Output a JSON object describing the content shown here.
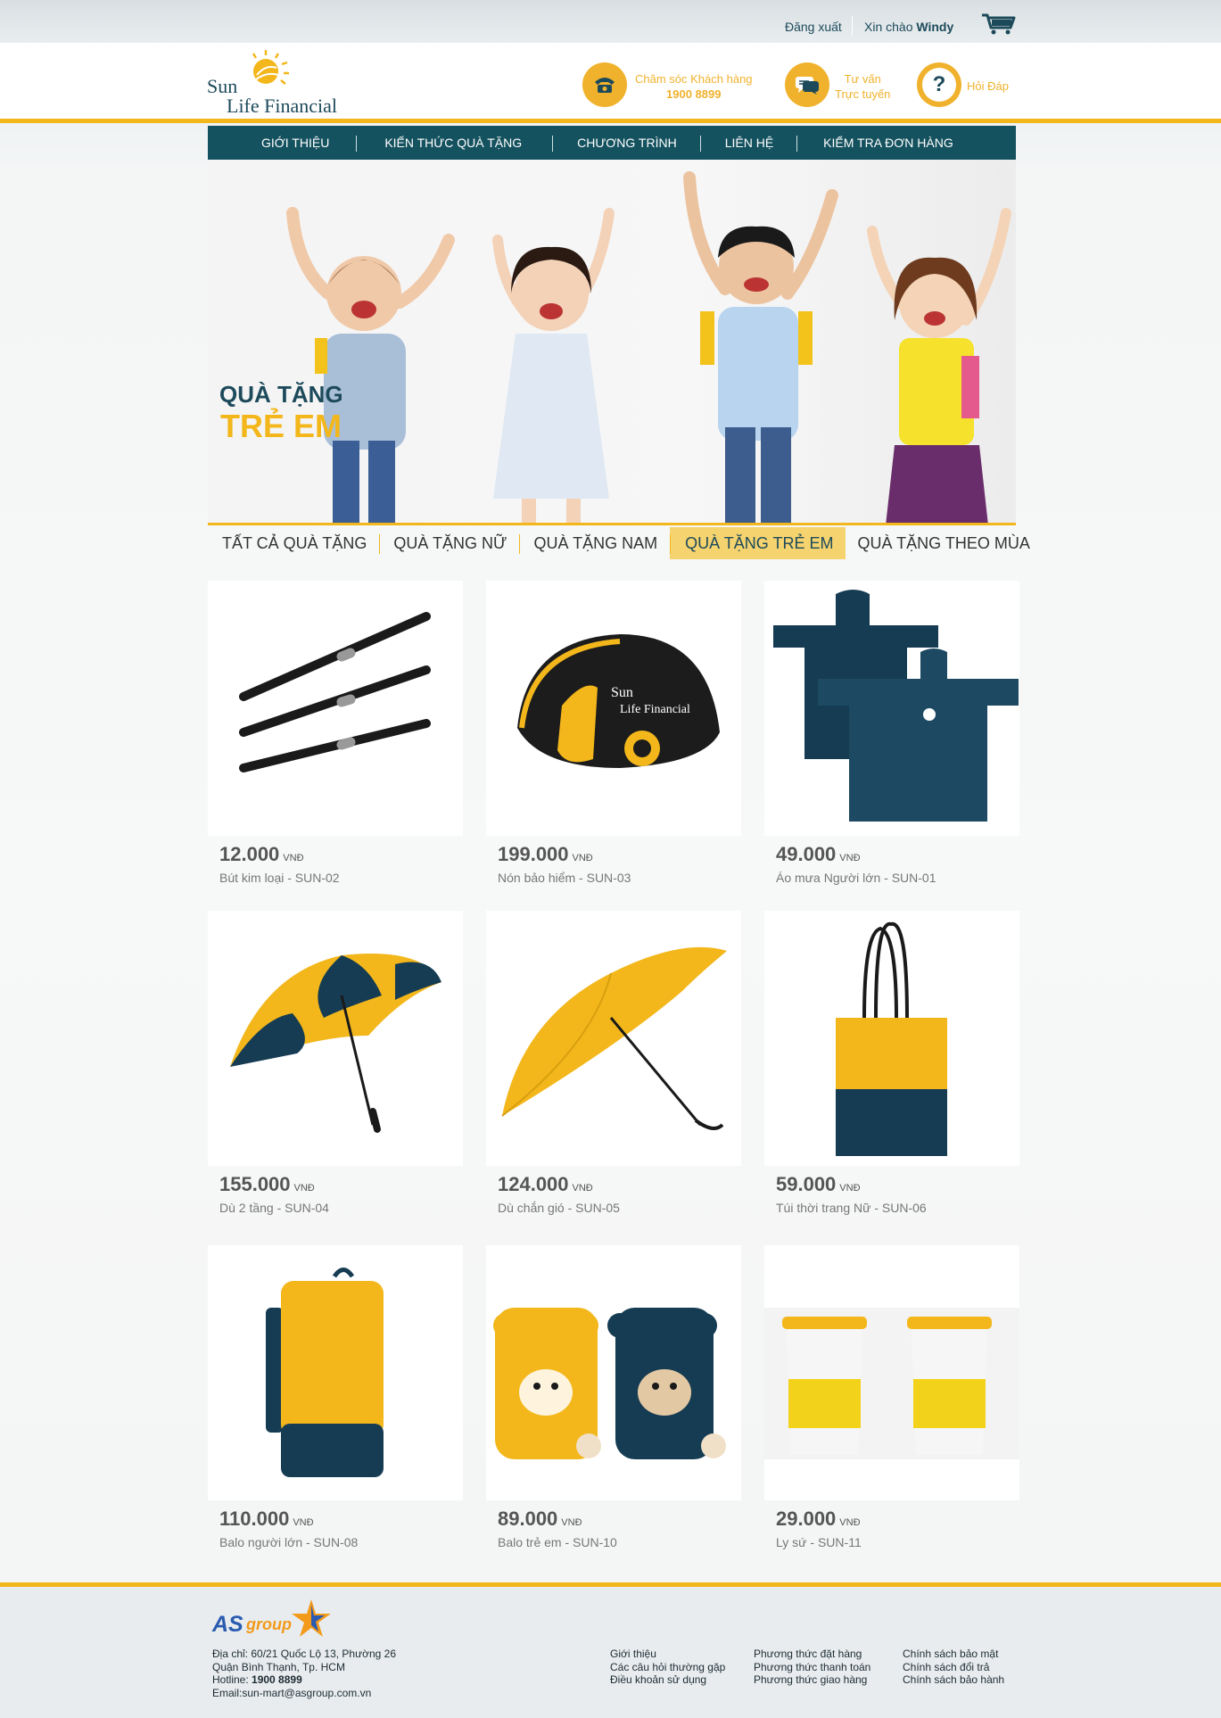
{
  "topbar": {
    "logout": "Đăng xuất",
    "greeting_prefix": "Xin chào",
    "username": "Windy",
    "cart_icon": "cart-icon"
  },
  "header": {
    "logo": {
      "line1": "Sun",
      "line2": "Life Financial"
    },
    "customer_care": {
      "label": "Chăm sóc Khách hàng",
      "phone": "1900 8899",
      "icon": "phone-icon"
    },
    "consult": {
      "line1": "Tư vấn",
      "line2": "Trực tuyến",
      "icon": "chat-icon"
    },
    "faq": {
      "label": "Hỏi Đáp",
      "icon": "question-icon"
    }
  },
  "nav": [
    "GIỚI THIỆU",
    "KIẾN THỨC QUÀ TẶNG",
    "CHƯƠNG TRÌNH",
    "LIÊN HỆ",
    "KIỂM TRA ĐƠN HÀNG"
  ],
  "banner": {
    "title1": "QUÀ TẶNG",
    "title2": "TRẺ EM"
  },
  "tabs": {
    "items": [
      "TẤT CẢ QUÀ TẶNG",
      "QUÀ TẶNG NỮ",
      "QUÀ TẶNG NAM",
      "QUÀ TẶNG TRẺ EM",
      "QUÀ TẶNG THEO MÙA"
    ],
    "active": "QUÀ TẶNG TRẺ EM"
  },
  "currency": "VNĐ",
  "products": [
    {
      "price": "12.000",
      "name": "Bút kim loại - SUN-02",
      "icon": "pen-image"
    },
    {
      "price": "199.000",
      "name": "Nón bảo hiểm - SUN-03",
      "icon": "helmet-image"
    },
    {
      "price": "49.000",
      "name": "Áo mưa Người lớn - SUN-01",
      "icon": "raincoat-image"
    },
    {
      "price": "155.000",
      "name": "Dù 2 tầng - SUN-04",
      "icon": "umbrella-image"
    },
    {
      "price": "124.000",
      "name": "Dù chắn gió - SUN-05",
      "icon": "umbrella-image"
    },
    {
      "price": "59.000",
      "name": "Túi thời trang Nữ - SUN-06",
      "icon": "tote-bag-image"
    },
    {
      "price": "110.000",
      "name": "Balo người lớn - SUN-08",
      "icon": "backpack-image"
    },
    {
      "price": "89.000",
      "name": "Balo trẻ em - SUN-10",
      "icon": "kids-backpack-image"
    },
    {
      "price": "29.000",
      "name": "Ly sứ - SUN-11",
      "icon": "cup-image"
    }
  ],
  "footer": {
    "logo": {
      "as": "AS",
      "group": "group"
    },
    "address_line1": "Địa chỉ: 60/21 Quốc Lộ 13, Phường 26",
    "address_line2": "Quận Bình Thạnh, Tp. HCM",
    "hotline_label": "Hotline:",
    "hotline": "1900 8899",
    "email": "Email:sun-mart@asgroup.com.vn",
    "col1": [
      "Giới thiệu",
      "Các câu hỏi thường gặp",
      "Điều khoản sử dụng"
    ],
    "col2": [
      "Phương thức đặt hàng",
      "Phương thức thanh toán",
      "Phương thức giao hàng"
    ],
    "col3": [
      "Chính sách bảo mật",
      "Chính sách đổi trả",
      "Chính sách bảo hành"
    ]
  }
}
